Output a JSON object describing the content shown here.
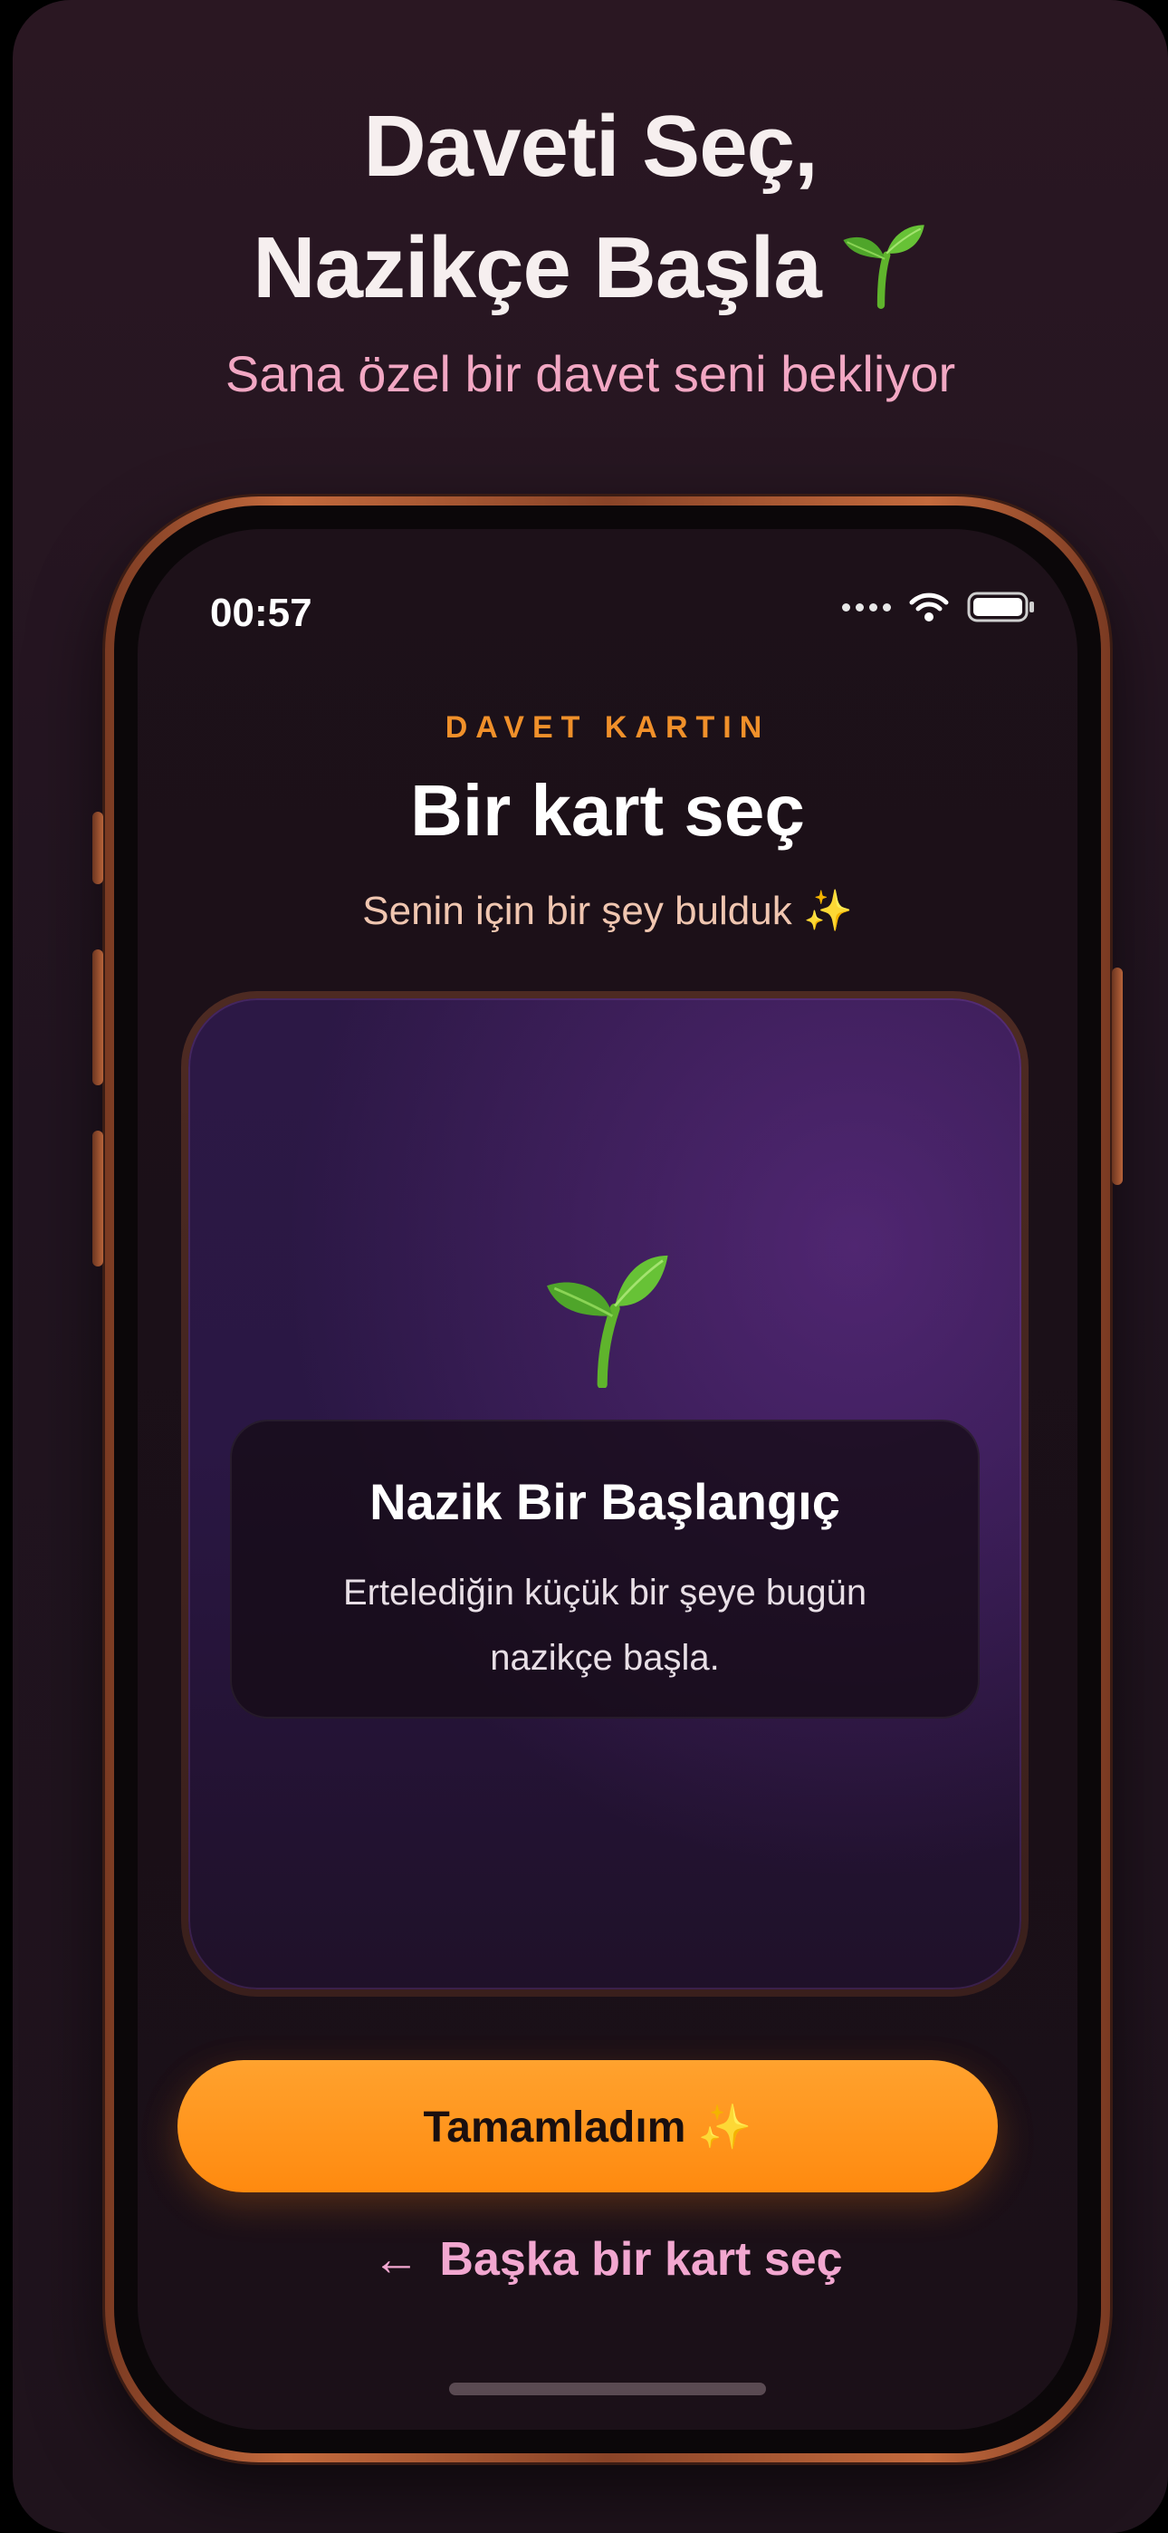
{
  "poster": {
    "headline_line1": "Daveti Seç,",
    "headline_line2": "Nazikçe Başla",
    "subtitle": "Sana özel bir davet seni bekliyor"
  },
  "status_bar": {
    "time": "00:57",
    "icons": [
      "cellular-dots-icon",
      "wifi-icon",
      "battery-icon"
    ]
  },
  "screen": {
    "eyebrow": "DAVET KARTIN",
    "title": "Bir kart seç",
    "subtitle": "Senin için bir şey bulduk ✨"
  },
  "card": {
    "icon": "sprout-icon",
    "title": "Nazik Bir Başlangıç",
    "body": "Ertelediğin küçük bir şeye bugün nazikçe başla."
  },
  "actions": {
    "primary_label": "Tamamladım ✨",
    "secondary_arrow": "←",
    "secondary_label": "Başka bir kart seç"
  },
  "colors": {
    "accent_orange": "#ff8a0f",
    "eyebrow_orange": "#f0902a",
    "pink_text": "#f2a7c3",
    "card_purple": "#2c1845"
  }
}
